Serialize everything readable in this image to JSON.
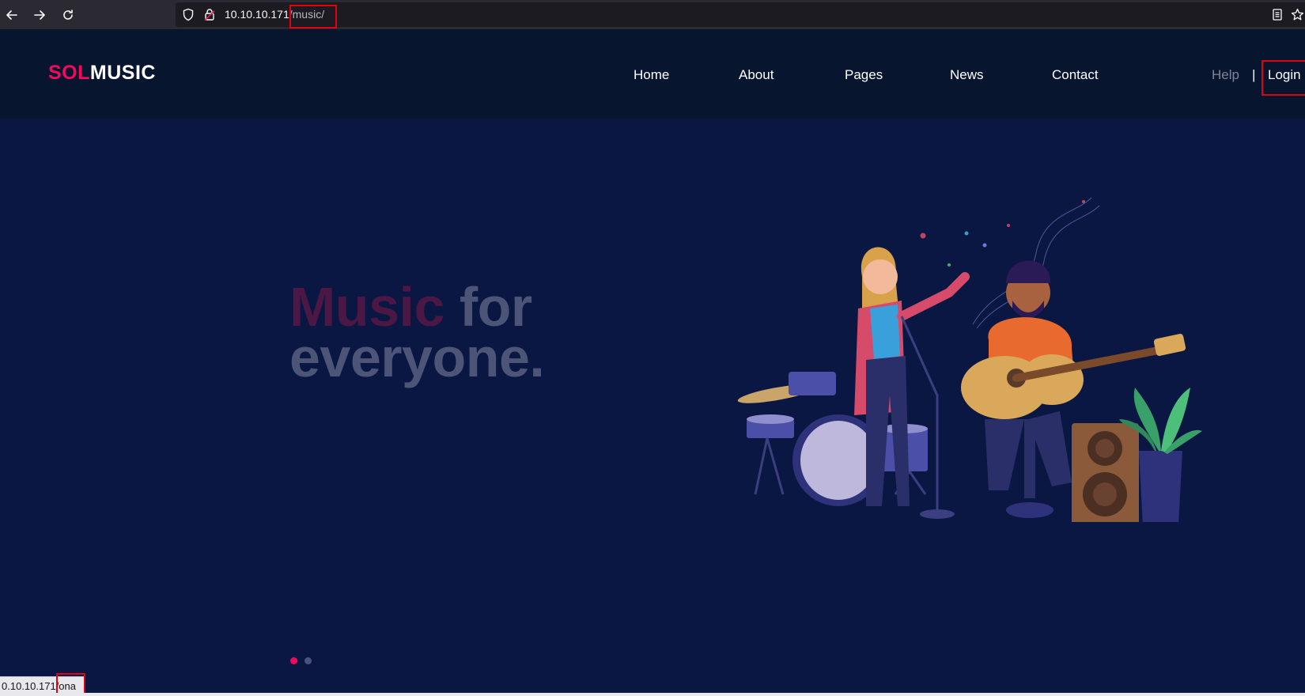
{
  "browser": {
    "url_host": "10.10.10.171",
    "url_path": "/music/",
    "status_host": "0.10.10.171",
    "status_path": "/ona",
    "icons": [
      "back-arrow-icon",
      "forward-arrow-icon",
      "reload-icon",
      "shield-icon",
      "lock-icon",
      "reader-mode-icon",
      "bookmark-star-icon"
    ]
  },
  "header": {
    "logo_part1": "SOL",
    "logo_part2": "MUSIC",
    "nav": [
      "Home",
      "About",
      "Pages",
      "News",
      "Contact"
    ],
    "help": "Help",
    "separator": "|",
    "login": "Login"
  },
  "hero": {
    "title_accent": "Music",
    "title_rest": " for",
    "title_line2": "everyone.",
    "slide_count": 2,
    "active_slide": 1
  },
  "colors": {
    "accent": "#f2095d",
    "header_bg": "#08152f",
    "hero_bg": "#0a1742",
    "highlight": "#e3000f"
  }
}
